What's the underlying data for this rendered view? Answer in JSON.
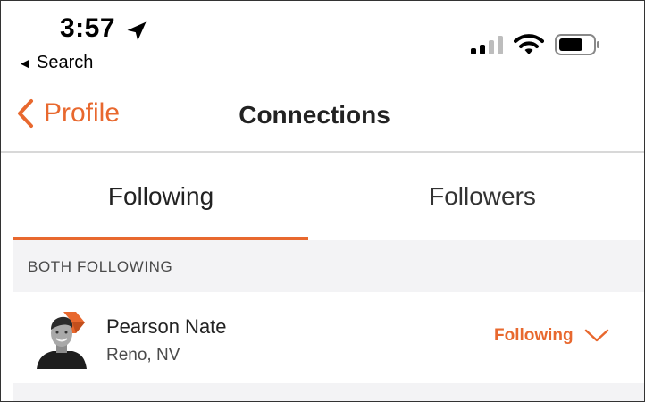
{
  "status_bar": {
    "time": "3:57",
    "back_app_label": "Search",
    "icons": [
      "location-arrow-icon",
      "cellular-signal-icon",
      "wifi-icon",
      "battery-icon"
    ]
  },
  "nav": {
    "back_label": "Profile",
    "title": "Connections"
  },
  "tabs": [
    {
      "label": "Following",
      "selected": true
    },
    {
      "label": "Followers",
      "selected": false
    }
  ],
  "section": {
    "title": "BOTH FOLLOWING"
  },
  "connections": [
    {
      "name": "Pearson Nate",
      "location": "Reno, NV",
      "action_label": "Following"
    }
  ],
  "colors": {
    "accent": "#e8682e",
    "section_bg": "#f3f3f5",
    "text": "#222222"
  }
}
